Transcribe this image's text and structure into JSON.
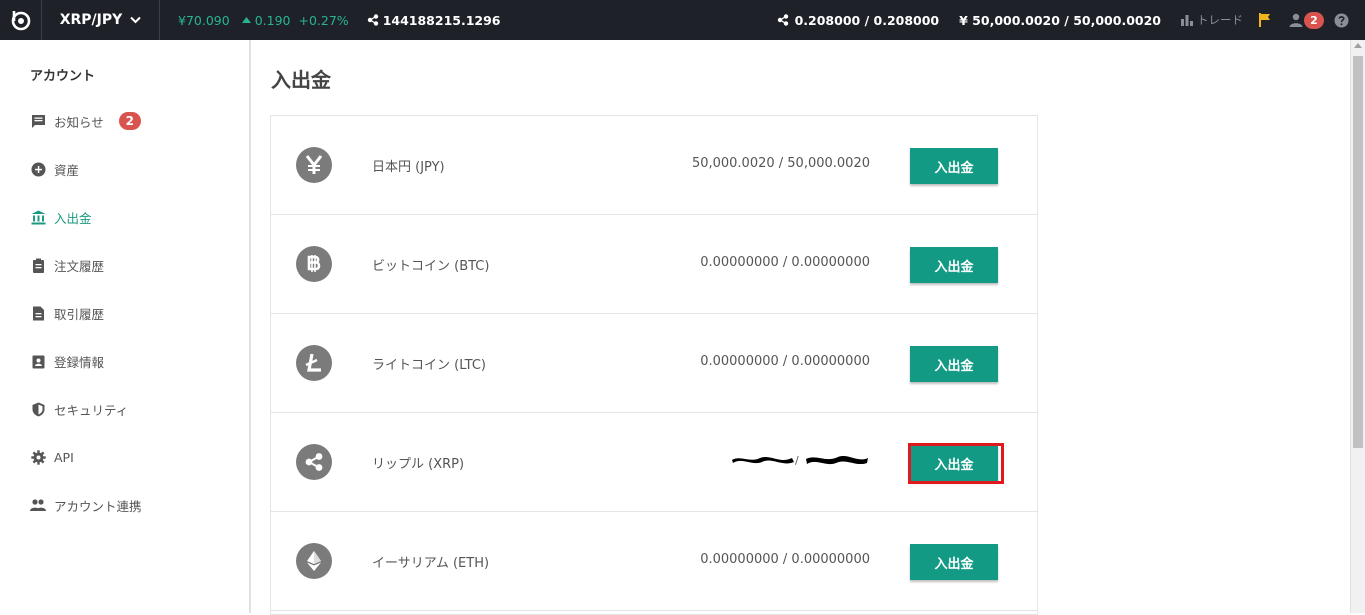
{
  "topbar": {
    "pair": "XRP/JPY",
    "price": "¥70.090",
    "change_value": "0.190",
    "change_pct": "+0.27%",
    "volume": "144188215.1296",
    "xrp_balance": "0.208000 / 0.208000",
    "jpy_balance": "¥  50,000.0020 / 50,000.0020",
    "trade_label": "トレード",
    "user_badge": "2"
  },
  "sidebar": {
    "heading": "アカウント",
    "items": [
      {
        "label": "お知らせ",
        "icon": "message-icon",
        "badge": "2"
      },
      {
        "label": "資産",
        "icon": "assets-icon"
      },
      {
        "label": "入出金",
        "icon": "bank-icon",
        "active": true
      },
      {
        "label": "注文履歴",
        "icon": "clipboard-icon"
      },
      {
        "label": "取引履歴",
        "icon": "document-icon"
      },
      {
        "label": "登録情報",
        "icon": "profile-card-icon"
      },
      {
        "label": "セキュリティ",
        "icon": "shield-icon"
      },
      {
        "label": "API",
        "icon": "gear-icon"
      },
      {
        "label": "アカウント連携",
        "icon": "people-icon"
      }
    ]
  },
  "main": {
    "title": "入出金",
    "rows": [
      {
        "name": "日本円 (JPY)",
        "balance": "50,000.0020 / 50,000.0020",
        "button": "入出金",
        "icon": "yen-icon"
      },
      {
        "name": "ビットコイン (BTC)",
        "balance": "0.00000000 / 0.00000000",
        "button": "入出金",
        "icon": "bitcoin-icon"
      },
      {
        "name": "ライトコイン (LTC)",
        "balance": "0.00000000 / 0.00000000",
        "button": "入出金",
        "icon": "litecoin-icon"
      },
      {
        "name": "リップル (XRP)",
        "balance": "",
        "button": "入出金",
        "icon": "ripple-icon",
        "redacted": true
      },
      {
        "name": "イーサリアム (ETH)",
        "balance": "0.00000000 / 0.00000000",
        "button": "入出金",
        "icon": "ethereum-icon"
      }
    ]
  },
  "colors": {
    "topbar_bg": "#1e2228",
    "accent_green": "#139a85",
    "badge_red": "#d9534f",
    "highlight_red": "#e0191f"
  }
}
